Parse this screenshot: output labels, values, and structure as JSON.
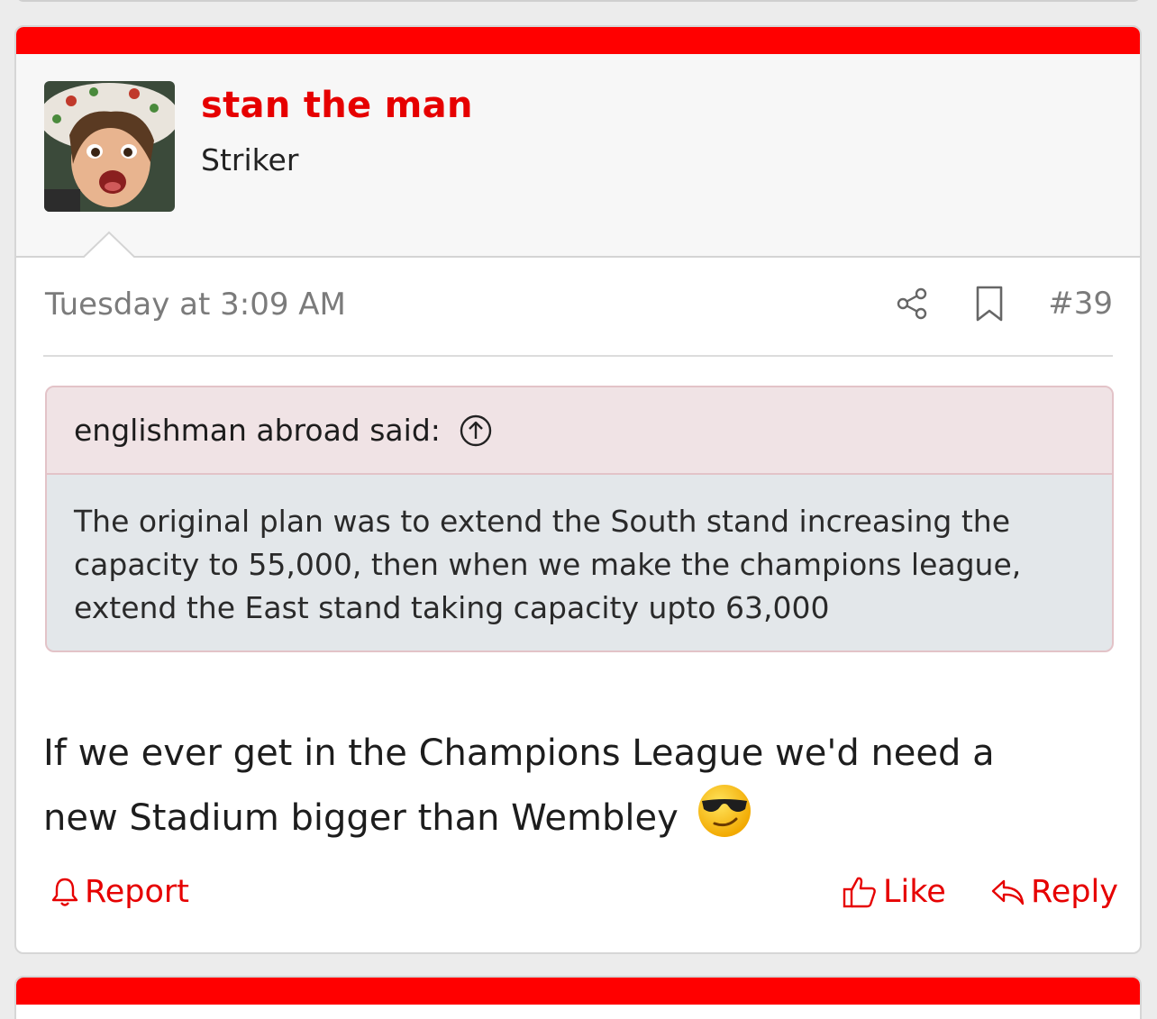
{
  "user": {
    "name": "stan the man",
    "title": "Striker"
  },
  "meta": {
    "date": "Tuesday at 3:09 AM",
    "post_number": "#39"
  },
  "quote": {
    "author": "englishman abroad said:",
    "text": "The original plan was to extend the South stand increasing the capacity to 55,000, then when we make the champions league, extend the East stand taking capacity upto 63,000"
  },
  "message": {
    "text": "If we ever get in the Champions League we'd need a new Stadium bigger than Wembley",
    "emoji": "sunglasses-emoji"
  },
  "actions": {
    "report": "Report",
    "like": "Like",
    "reply": "Reply"
  },
  "colors": {
    "accent": "#ff0000",
    "link": "#e60000",
    "quote_head_bg": "#f0e3e5",
    "quote_body_bg": "#e3e7ea"
  }
}
